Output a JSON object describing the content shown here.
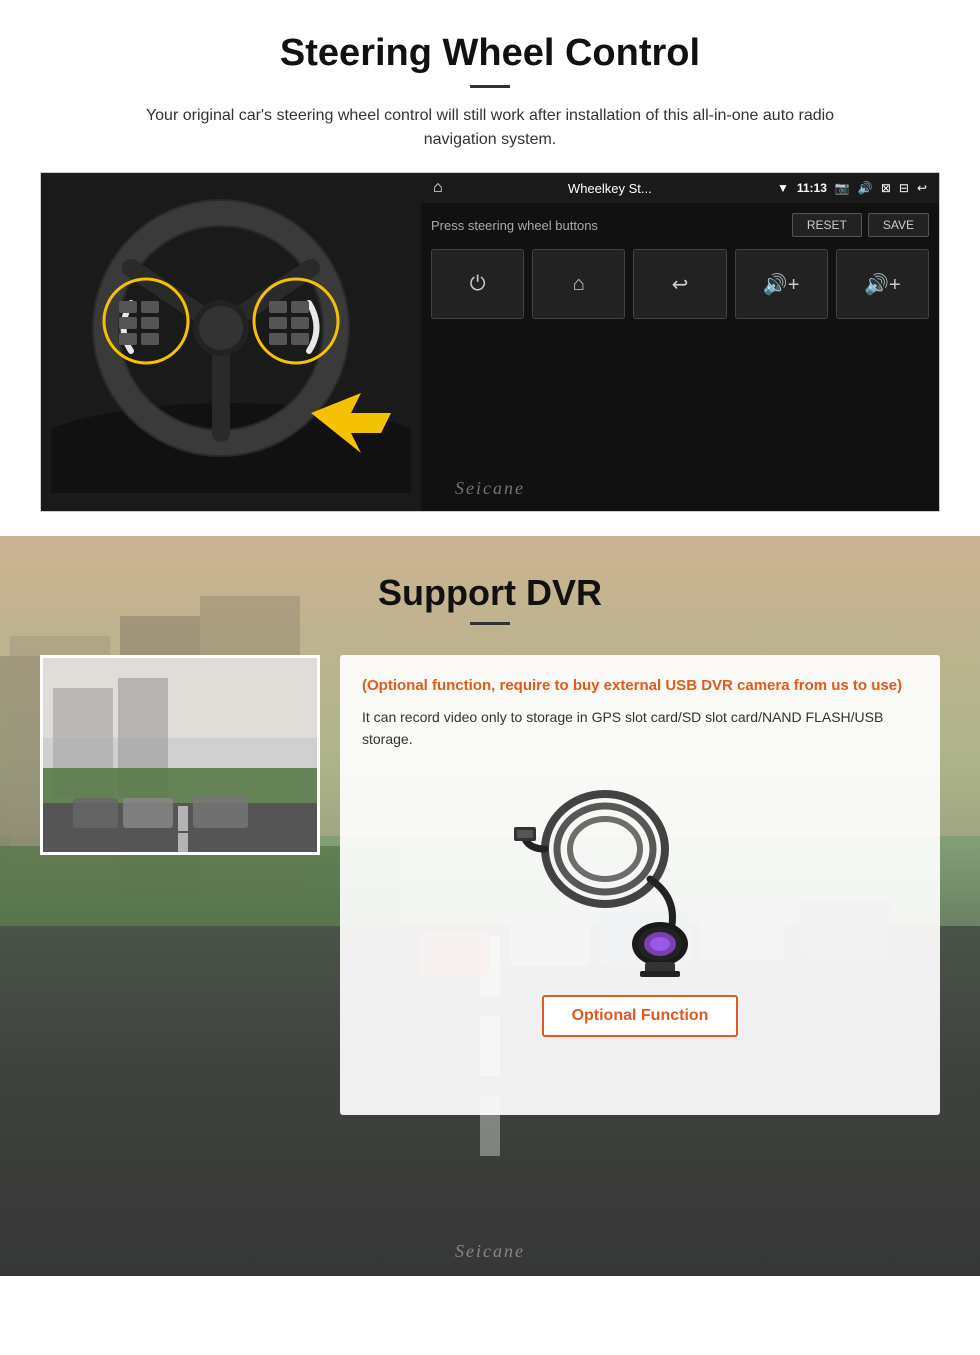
{
  "steering_section": {
    "title": "Steering Wheel Control",
    "subtitle": "Your original car's steering wheel control will still work after installation of this all-in-one auto radio navigation system.",
    "android": {
      "app_name": "Wheelkey St...",
      "time": "11:13",
      "prompt": "Press steering wheel buttons",
      "reset_btn": "RESET",
      "save_btn": "SAVE",
      "buttons": [
        "⏻",
        "⌂",
        "↩",
        "🔊+",
        "🔊+"
      ]
    },
    "seicane_watermark": "Seicane"
  },
  "dvr_section": {
    "title": "Support DVR",
    "optional_note": "(Optional function, require to buy external USB DVR camera from us to use)",
    "description": "It can record video only to storage in GPS slot card/SD slot card/NAND FLASH/USB storage.",
    "optional_function_label": "Optional Function",
    "seicane_watermark": "Seicane"
  }
}
